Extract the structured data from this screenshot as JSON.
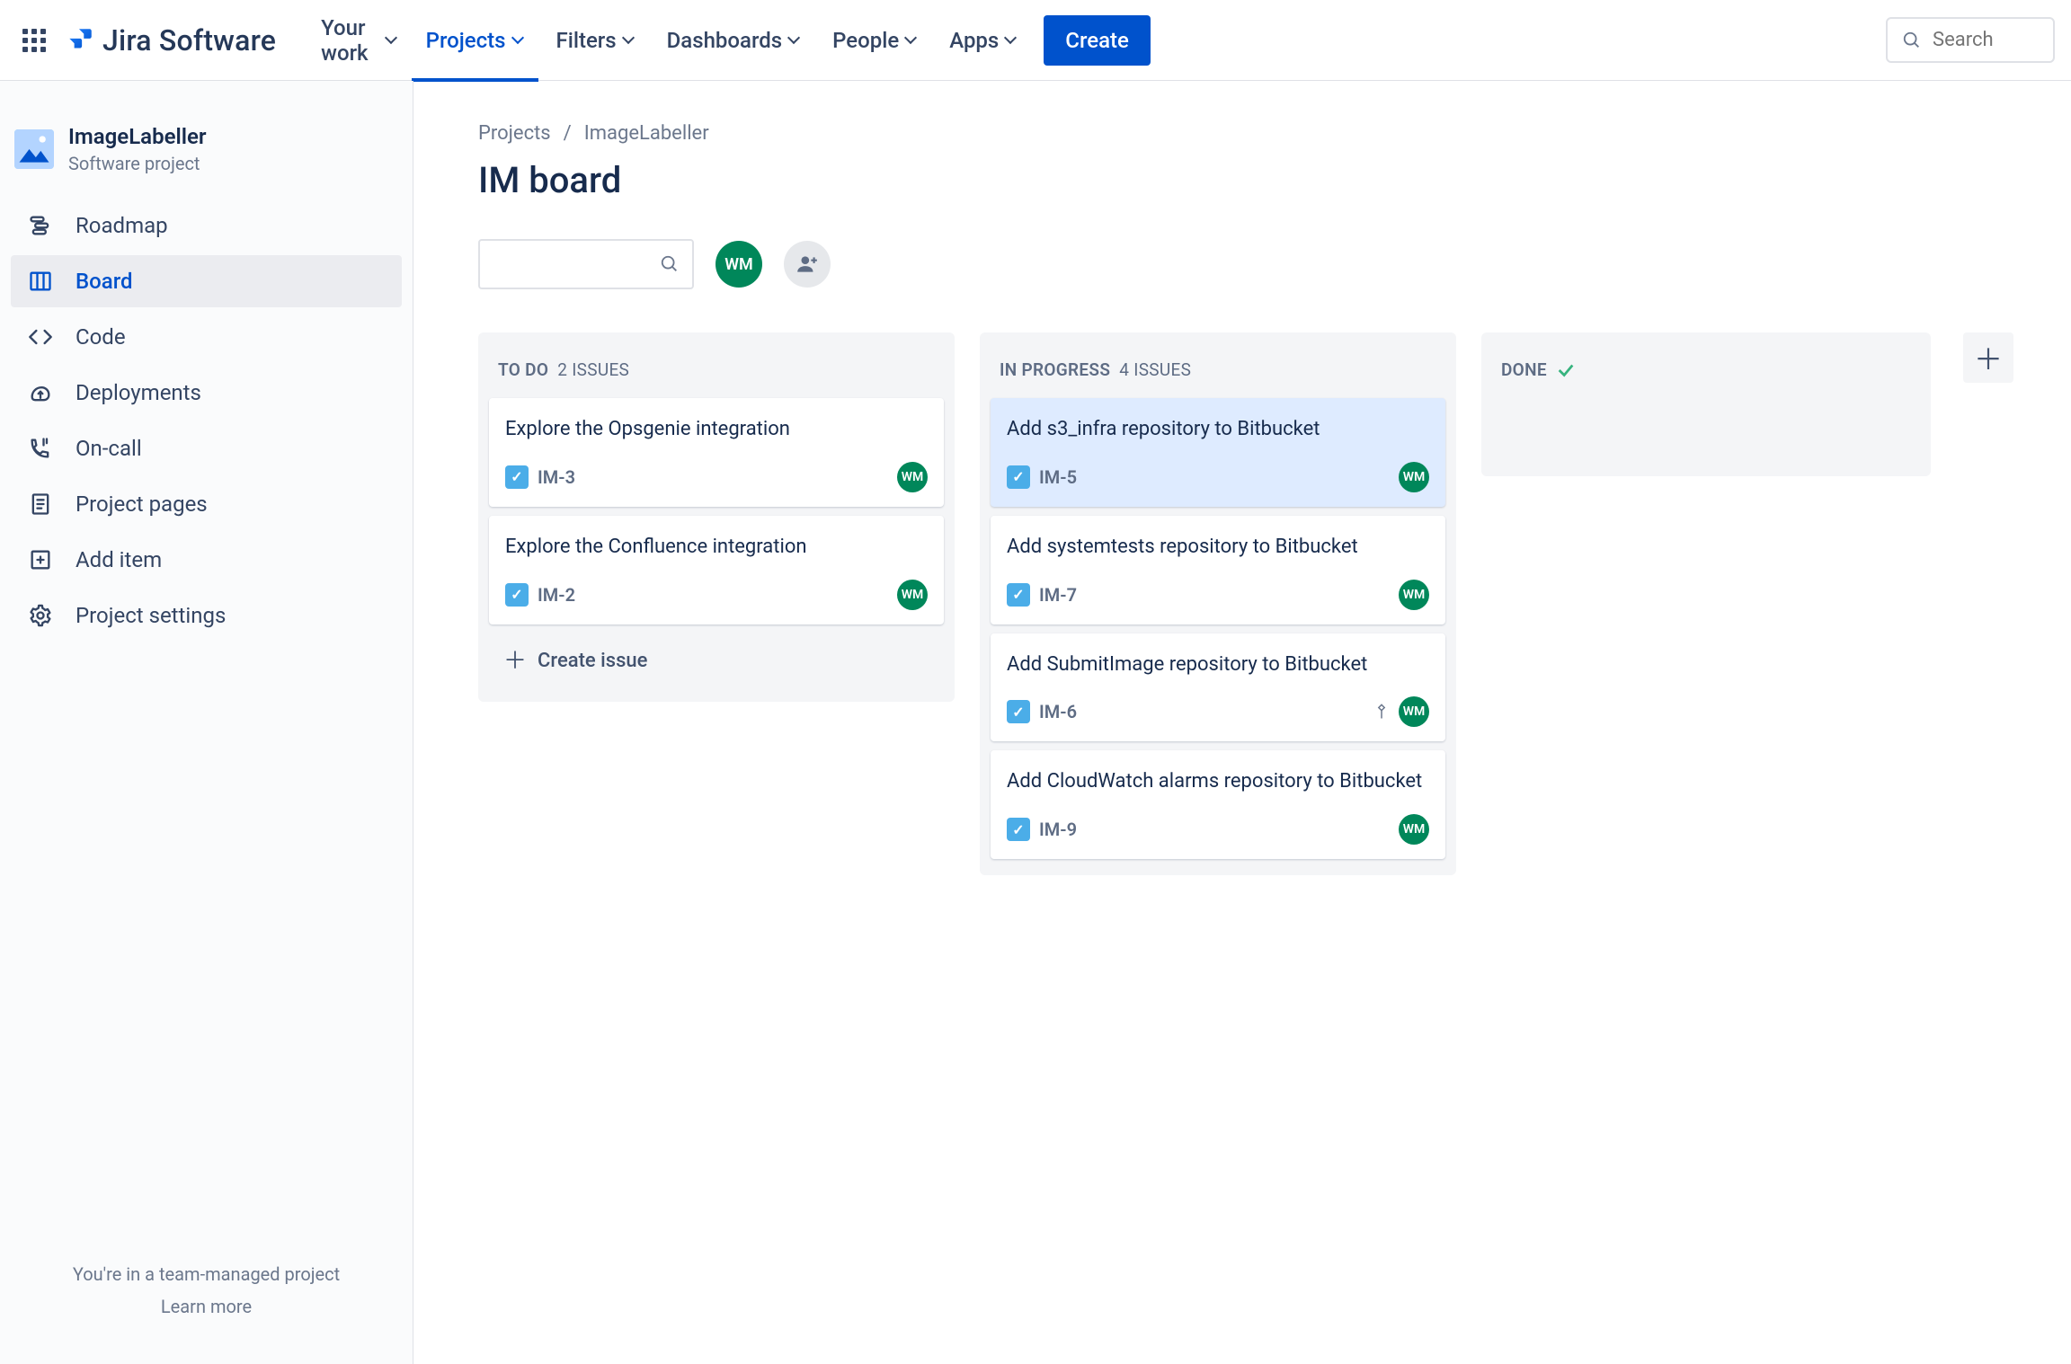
{
  "nav": {
    "brand": "Jira Software",
    "items": [
      "Your work",
      "Projects",
      "Filters",
      "Dashboards",
      "People",
      "Apps"
    ],
    "active_index": 1,
    "create_label": "Create",
    "search_placeholder": "Search"
  },
  "sidebar": {
    "project_name": "ImageLabeller",
    "project_type": "Software project",
    "items": [
      {
        "icon": "roadmap",
        "label": "Roadmap"
      },
      {
        "icon": "board",
        "label": "Board"
      },
      {
        "icon": "code",
        "label": "Code"
      },
      {
        "icon": "deployments",
        "label": "Deployments"
      },
      {
        "icon": "oncall",
        "label": "On-call"
      },
      {
        "icon": "pages",
        "label": "Project pages"
      },
      {
        "icon": "add",
        "label": "Add item"
      },
      {
        "icon": "settings",
        "label": "Project settings"
      }
    ],
    "selected_index": 1,
    "footer_text": "You're in a team-managed project",
    "footer_link": "Learn more"
  },
  "main": {
    "breadcrumb": [
      "Projects",
      "ImageLabeller"
    ],
    "title": "IM board",
    "assignee_initials": "WM",
    "create_issue_label": "Create issue"
  },
  "columns": [
    {
      "name": "TO DO",
      "count_label": "2 ISSUES",
      "done": false,
      "cards": [
        {
          "title": "Explore the Opsgenie integration",
          "key": "IM-3",
          "assignee": "WM",
          "highlighted": false,
          "priority": null
        },
        {
          "title": "Explore the Confluence integration",
          "key": "IM-2",
          "assignee": "WM",
          "highlighted": false,
          "priority": null
        }
      ],
      "show_create": true
    },
    {
      "name": "IN PROGRESS",
      "count_label": "4 ISSUES",
      "done": false,
      "cards": [
        {
          "title": "Add s3_infra repository to Bitbucket",
          "key": "IM-5",
          "assignee": "WM",
          "highlighted": true,
          "priority": null
        },
        {
          "title": "Add systemtests repository to Bitbucket",
          "key": "IM-7",
          "assignee": "WM",
          "highlighted": false,
          "priority": null
        },
        {
          "title": "Add SubmitImage repository to Bitbucket",
          "key": "IM-6",
          "assignee": "WM",
          "highlighted": false,
          "priority": "medium"
        },
        {
          "title": "Add CloudWatch alarms repository to Bitbucket",
          "key": "IM-9",
          "assignee": "WM",
          "highlighted": false,
          "priority": null
        }
      ],
      "show_create": false
    },
    {
      "name": "DONE",
      "count_label": "",
      "done": true,
      "cards": [],
      "show_create": false
    }
  ]
}
